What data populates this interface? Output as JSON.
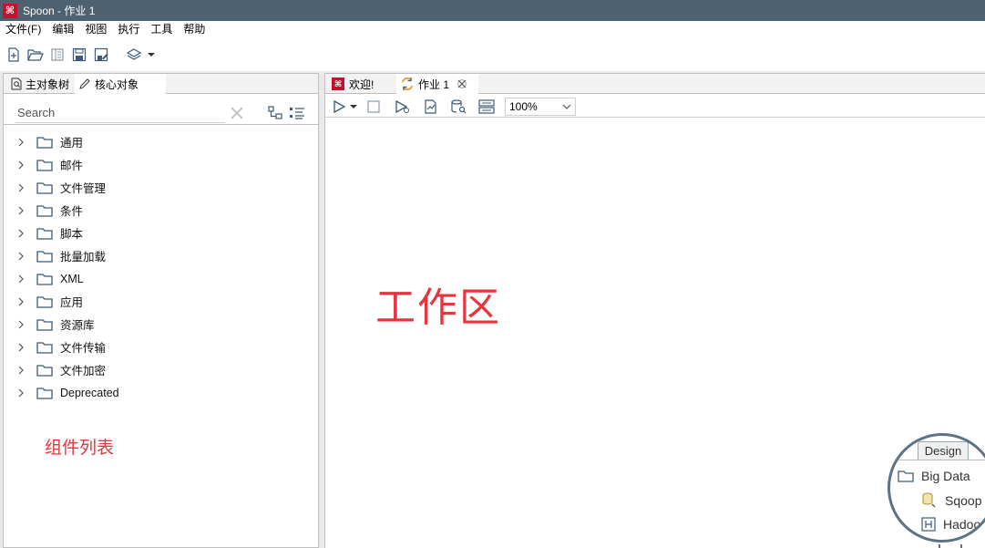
{
  "window": {
    "title": "Spoon - 作业 1",
    "logo": "⌘"
  },
  "menu": [
    "文件(F)",
    "编辑",
    "视图",
    "执行",
    "工具",
    "帮助"
  ],
  "toolbar_icons": [
    "new-file-icon",
    "open-folder-icon",
    "explore-repo-icon",
    "save-icon",
    "save-as-icon",
    "layers-icon",
    "dropdown-arrow-icon"
  ],
  "left_panel": {
    "tabs": {
      "main_tree": "主对象树",
      "core_objects": "核心对象"
    },
    "search": {
      "placeholder": "Search"
    },
    "tree_items": [
      "通用",
      "邮件",
      "文件管理",
      "条件",
      "脚本",
      "批量加载",
      "XML",
      "应用",
      "资源库",
      "文件传输",
      "文件加密",
      "Deprecated"
    ],
    "annotation": "组件列表"
  },
  "right_panel": {
    "tabs": {
      "welcome": "欢迎!",
      "job": "作业 1"
    },
    "zoom": "100%",
    "annotation": "工作区",
    "magnifier": {
      "tab": "Design",
      "folder": "Big Data",
      "items": [
        "Sqoop",
        "Hadoop"
      ]
    }
  },
  "colors": {
    "titlebar": "#4e6170",
    "annotation": "#e8343c",
    "logo": "#c8102e",
    "icon": "#3e5a75"
  }
}
